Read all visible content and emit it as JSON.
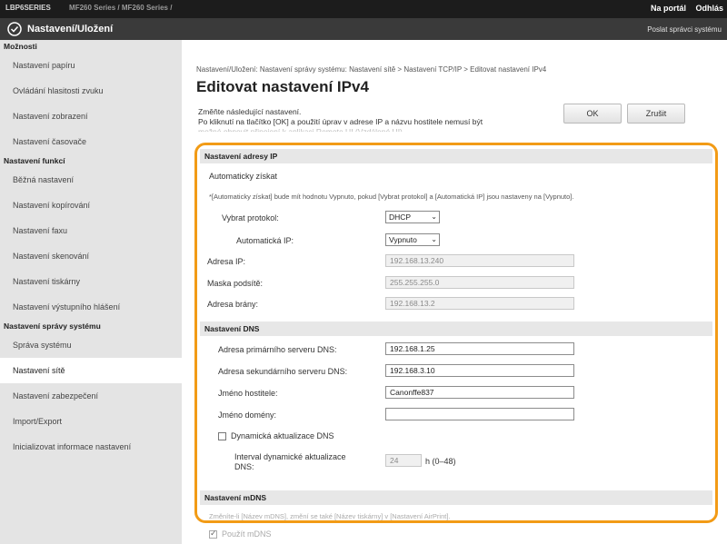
{
  "topbar": {
    "device": "LBP6SERIES",
    "device_sub": "MF260 Series / MF260 Series /",
    "portal_link": "Na portál",
    "logout_link": "Odhlás"
  },
  "header": {
    "title": "Nastavení/Uložení",
    "send_link": "Poslat správci systému"
  },
  "sidebar": {
    "sections": [
      {
        "title": "Možnosti",
        "items": [
          "Nastavení papíru",
          "Ovládání hlasitosti zvuku",
          "Nastavení zobrazení",
          "Nastavení časovače"
        ]
      },
      {
        "title": "Nastavení funkcí",
        "items": [
          "Běžná nastavení",
          "Nastavení kopírování",
          "Nastavení faxu",
          "Nastavení skenování",
          "Nastavení tiskárny",
          "Nastavení výstupního hlášení"
        ]
      },
      {
        "title": "Nastavení správy systému",
        "items": [
          "Správa systému",
          "Nastavení sítě",
          "Nastavení zabezpečení",
          "Import/Export",
          "Inicializovat informace nastavení"
        ]
      }
    ]
  },
  "main": {
    "breadcrumb": "Nastavení/Uložení: Nastavení správy systému: Nastavení sítě > Nastavení TCP/IP > Editovat nastavení IPv4",
    "title": "Editovat nastavení IPv4",
    "info_line1": "Změňte následující nastavení.",
    "info_line2": "Po kliknutí na tlačítko [OK] a použití úprav v adrese IP a názvu hostitele nemusí být",
    "info_line3": "možné obnovit připojení k aplikaci Remote UI (Vzdálené UI).",
    "ok_label": "OK",
    "cancel_label": "Zrušit"
  },
  "ip_section": {
    "title": "Nastavení adresy IP",
    "auto_get": "Automaticky získat",
    "note": "*[Automaticky získat] bude mít hodnotu Vypnuto, pokud [Vybrat protokol] a [Automatická IP] jsou nastaveny na [Vypnuto].",
    "protocol_label": "Vybrat protokol:",
    "protocol_value": "DHCP",
    "autoip_label": "Automatická IP:",
    "autoip_value": "Vypnuto",
    "ip_label": "Adresa IP:",
    "ip_value": "192.168.13.240",
    "mask_label": "Maska podsítě:",
    "mask_value": "255.255.255.0",
    "gateway_label": "Adresa brány:",
    "gateway_value": "192.168.13.2"
  },
  "dns_section": {
    "title": "Nastavení DNS",
    "primary_label": "Adresa primárního serveru DNS:",
    "primary_value": "192.168.1.25",
    "secondary_label": "Adresa sekundárního serveru DNS:",
    "secondary_value": "192.168.3.10",
    "host_label": "Jméno hostitele:",
    "host_value": "Canonffe837",
    "domain_label": "Jméno domény:",
    "domain_value": "",
    "dyn_label": "Dynamická aktualizace DNS",
    "dyn_checked": false,
    "interval_label1": "Interval dynamické aktualizace",
    "interval_label2": "DNS:",
    "interval_value": "24",
    "interval_unit": "h (0–48)"
  },
  "mdns_section": {
    "title": "Nastavení mDNS",
    "note": "Změníte-li [Název mDNS], změní se také [Název tiskárny] v [Nastavení AirPrint].",
    "use_label": "Použít mDNS",
    "use_checked": true
  },
  "colors": {
    "highlight": "#f29b16",
    "header_bg": "#3a3a3a",
    "topbar_bg": "#1c1c1c",
    "sidebar_bg": "#e4e4e4"
  }
}
